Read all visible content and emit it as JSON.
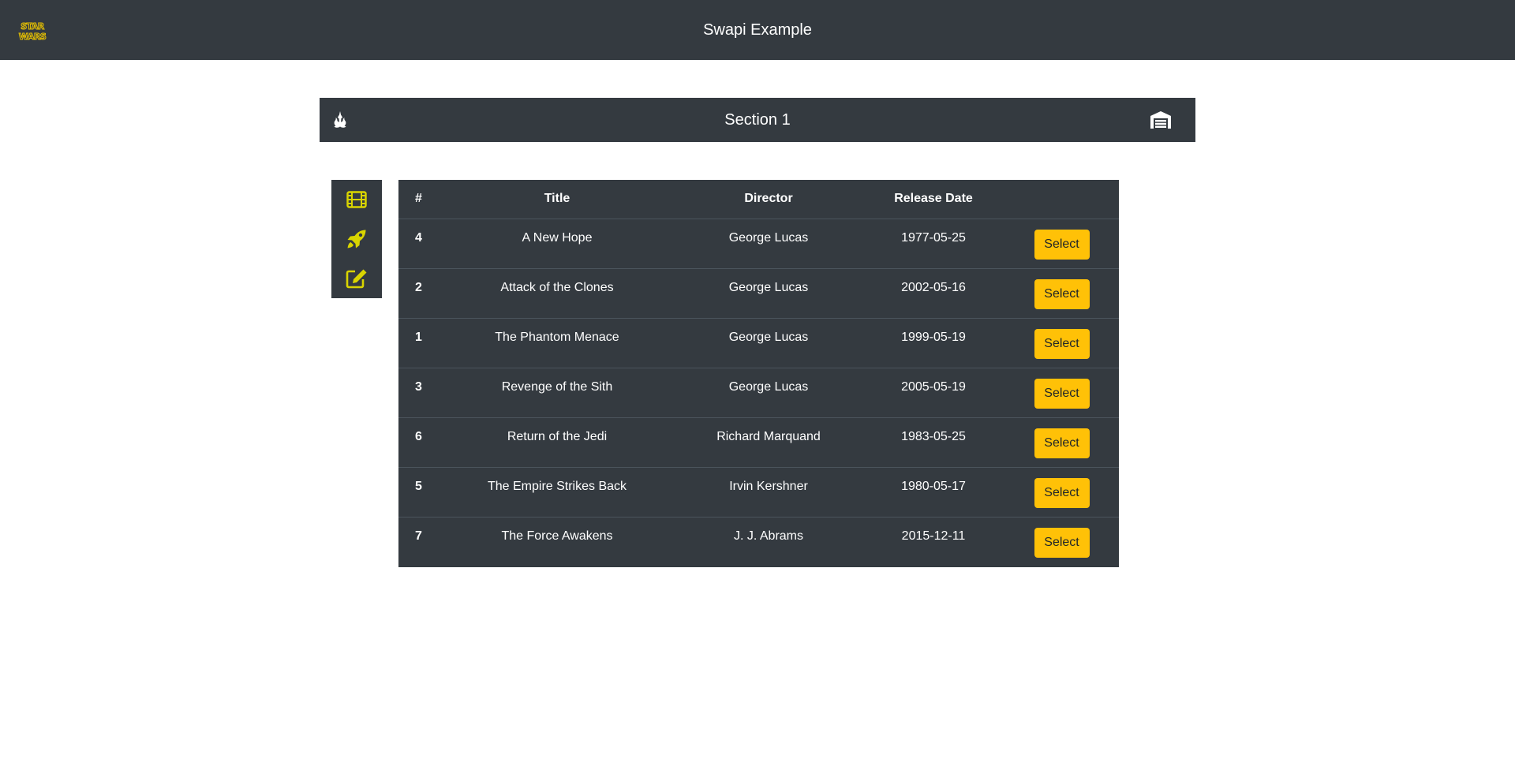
{
  "navbar": {
    "logo_text": "STAR WARS",
    "title": "Swapi Example"
  },
  "section": {
    "title": "Section 1",
    "left_icon": "jedi-order-icon",
    "right_icon": "warehouse-icon"
  },
  "sidebar": {
    "items": [
      {
        "icon": "film-icon",
        "color": "#d9d400"
      },
      {
        "icon": "rocket-icon",
        "color": "#d9d400"
      },
      {
        "icon": "edit-icon",
        "color": "#d9d400"
      }
    ]
  },
  "table": {
    "headers": [
      "#",
      "Title",
      "Director",
      "Release Date",
      ""
    ],
    "rows": [
      {
        "episode": "4",
        "title": "A New Hope",
        "director": "George Lucas",
        "release_date": "1977-05-25",
        "action": "Select"
      },
      {
        "episode": "2",
        "title": "Attack of the Clones",
        "director": "George Lucas",
        "release_date": "2002-05-16",
        "action": "Select"
      },
      {
        "episode": "1",
        "title": "The Phantom Menace",
        "director": "George Lucas",
        "release_date": "1999-05-19",
        "action": "Select"
      },
      {
        "episode": "3",
        "title": "Revenge of the Sith",
        "director": "George Lucas",
        "release_date": "2005-05-19",
        "action": "Select"
      },
      {
        "episode": "6",
        "title": "Return of the Jedi",
        "director": "Richard Marquand",
        "release_date": "1983-05-25",
        "action": "Select"
      },
      {
        "episode": "5",
        "title": "The Empire Strikes Back",
        "director": "Irvin Kershner",
        "release_date": "1980-05-17",
        "action": "Select"
      },
      {
        "episode": "7",
        "title": "The Force Awakens",
        "director": "J. J. Abrams",
        "release_date": "2015-12-11",
        "action": "Select"
      }
    ]
  },
  "colors": {
    "dark": "#343a40",
    "accent": "#ffc107",
    "icon_yellow": "#d9d400",
    "logo_yellow": "#e8c200"
  }
}
